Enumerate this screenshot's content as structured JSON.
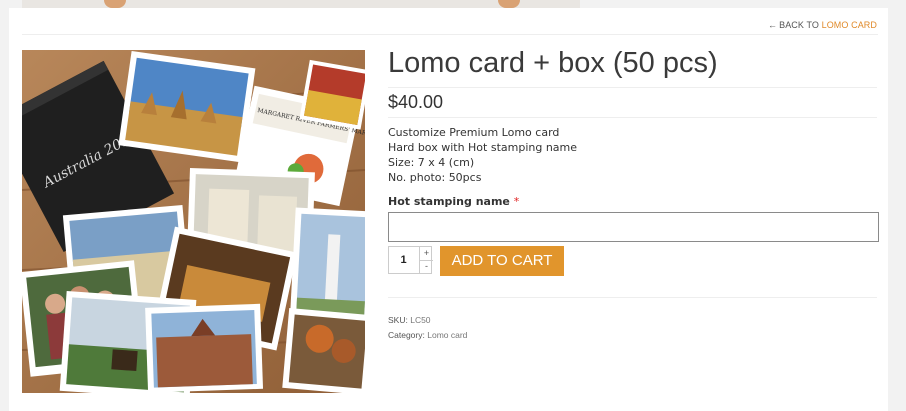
{
  "back": {
    "prefix": "BACK TO",
    "link": "LOMO CARD"
  },
  "product": {
    "title": "Lomo card + box (50 pcs)",
    "price": "$40.00",
    "description": [
      "Customize Premium Lomo card",
      "Hard box with Hot stamping name",
      "Size: 7 x 4 (cm)",
      "No. photo: 50pcs"
    ],
    "image_box_text": "Australia 2016",
    "image_card_text": "MARGARET RIVER FARMERS' MARKET"
  },
  "form": {
    "field_label": "Hot stamping name",
    "required_mark": "*",
    "field_value": "",
    "quantity": "1",
    "plus": "+",
    "minus": "-",
    "add_to_cart": "ADD TO CART"
  },
  "meta": {
    "sku_label": "SKU:",
    "sku": "LC50",
    "category_label": "Category:",
    "category": "Lomo card"
  },
  "colors": {
    "accent": "#e1952c",
    "link": "#e08a2a",
    "required": "#e02020"
  }
}
